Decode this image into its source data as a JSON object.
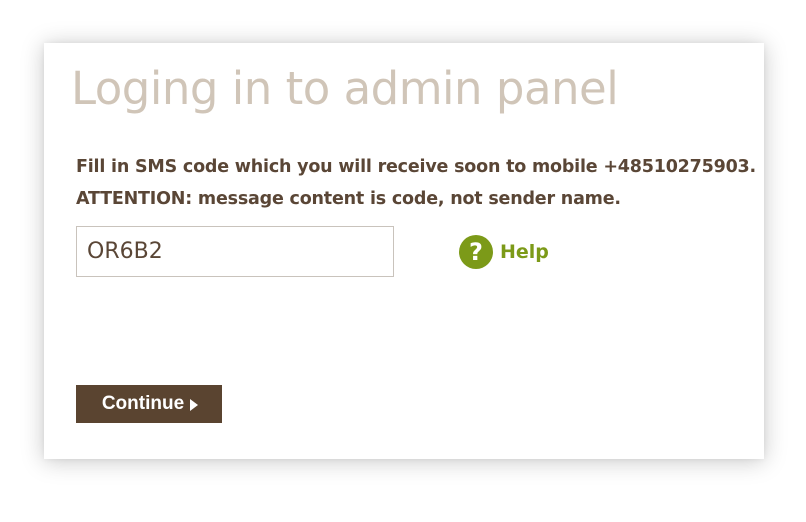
{
  "page": {
    "title": "Loging in to admin panel"
  },
  "instructions": {
    "line1": "Fill in SMS code which you will receive soon to mobile +48510275903.",
    "line2": "ATTENTION: message content is code, not sender name."
  },
  "sms_code": {
    "value": "OR6B2"
  },
  "help": {
    "icon": "question-mark-circle-icon",
    "icon_glyph": "?",
    "label": "Help"
  },
  "continue_button": {
    "label": "Continue",
    "icon": "triangle-right-arrow-icon"
  },
  "colors": {
    "title": "#d0c5b8",
    "text": "#5a4636",
    "accent_green": "#7c9a18",
    "button_bg": "#5a4430"
  }
}
